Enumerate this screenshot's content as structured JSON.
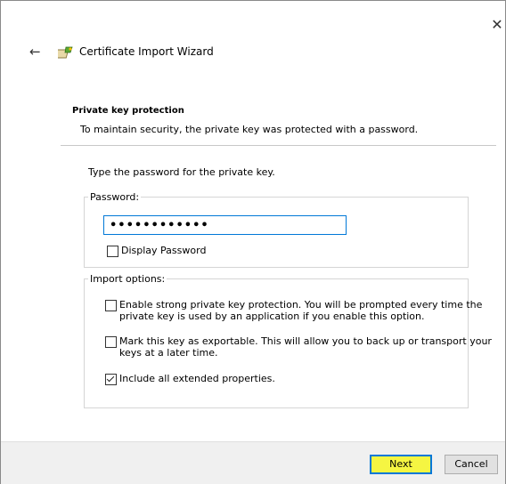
{
  "window": {
    "close_glyph": "✕",
    "back_glyph": "←"
  },
  "wizard": {
    "title": "Certificate Import Wizard",
    "icon": "certificate-icon"
  },
  "section": {
    "title": "Private key protection",
    "description": "To maintain security, the private key was protected with a password."
  },
  "instruction": "Type the password for the private key.",
  "password_group": {
    "legend": "Password:",
    "value": "••••••••••••",
    "display_password": {
      "label": "Display Password",
      "checked": false
    }
  },
  "import_options": {
    "legend": "Import options:",
    "strong_protection": {
      "line1": "Enable strong private key protection. You will be prompted every time the",
      "line2": "private key is used by an application if you enable this option.",
      "checked": false
    },
    "exportable": {
      "line1": "Mark this key as exportable. This will allow you to back up or transport your",
      "line2": "keys at a later time.",
      "checked": false
    },
    "extended_properties": {
      "label": "Include all extended properties.",
      "checked": true
    }
  },
  "footer": {
    "next_label": "Next",
    "cancel_label": "Cancel"
  },
  "colors": {
    "focus_border": "#0078d7",
    "next_highlight": "#f5f542",
    "footer_bg": "#f0f0f0"
  }
}
